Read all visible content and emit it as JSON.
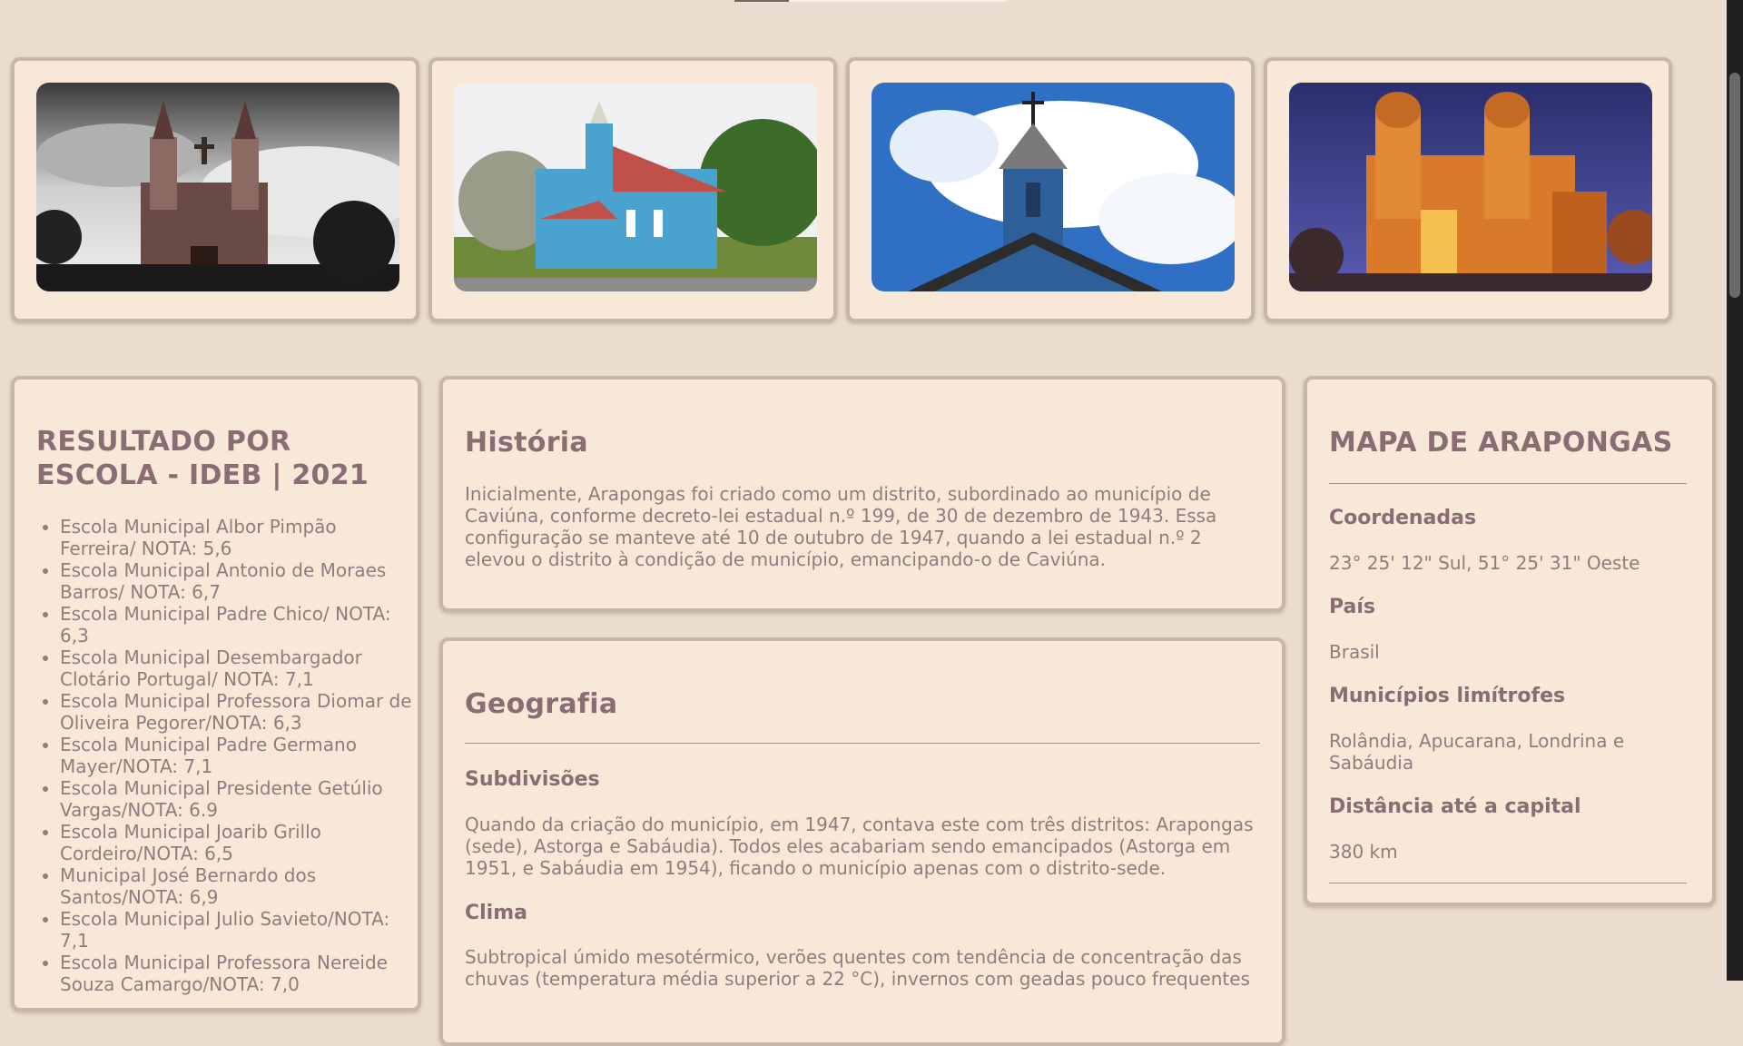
{
  "gallery": [
    {
      "alt": "church-sepia-twin-towers-icon"
    },
    {
      "alt": "blue-wooden-church-icon"
    },
    {
      "alt": "blue-chapel-tower-sky-icon"
    },
    {
      "alt": "illuminated-cathedral-night-icon"
    }
  ],
  "ideb": {
    "title": "RESULTADO POR ESCOLA - IDEB | 2021",
    "items": [
      "Escola Municipal Albor Pimpão Ferreira/ NOTA: 5,6",
      "Escola Municipal Antonio de Moraes Barros/ NOTA: 6,7",
      "Escola Municipal Padre Chico/ NOTA: 6,3",
      "Escola Municipal Desembargador Clotário Portugal/ NOTA: 7,1",
      "Escola Municipal Professora Diomar de Oliveira Pegorer/NOTA: 6,3",
      "Escola Municipal Padre Germano Mayer/NOTA: 7,1",
      "Escola Municipal Presidente Getúlio Vargas/NOTA: 6.9",
      "Escola Municipal Joarib Grillo Cordeiro/NOTA: 6,5",
      "Municipal José Bernardo dos Santos/NOTA: 6,9",
      "Escola Municipal Julio Savieto/NOTA: 7,1",
      "Escola Municipal Professora Nereide Souza Camargo/NOTA: 7,0"
    ]
  },
  "historia": {
    "title": "História",
    "text": "Inicialmente, Arapongas foi criado como um distrito, subordinado ao município de Caviúna, conforme decreto-lei estadual n.º 199, de 30 de dezembro de 1943. Essa configuração se manteve até 10 de outubro de 1947, quando a lei estadual n.º 2 elevou o distrito à condição de município, emancipando-o de Caviúna."
  },
  "geografia": {
    "title": "Geografia",
    "subdivisoes_title": "Subdivisões",
    "subdivisoes_text": "Quando da criação do município, em 1947, contava este com três distritos: Arapongas (sede), Astorga e Sabáudia). Todos eles acabariam sendo emancipados (Astorga em 1951, e Sabáudia em 1954), ficando o município apenas com o distrito-sede.",
    "clima_title": "Clima",
    "clima_text": "Subtropical úmido mesotérmico, verões quentes com tendência de concentração das chuvas (temperatura média superior a 22 °C), invernos com geadas pouco frequentes"
  },
  "mapa": {
    "title": "MAPA DE ARAPONGAS",
    "coordenadas_label": "Coordenadas",
    "coordenadas_value": "23° 25' 12\" Sul, 51° 25' 31\" Oeste",
    "pais_label": "País",
    "pais_value": "Brasil",
    "limitrofes_label": "Municípios limítrofes",
    "limitrofes_value": "Rolândia, Apucarana, Londrina e Sabáudia",
    "distancia_label": "Distância até a capital",
    "distancia_value": "380 km"
  }
}
